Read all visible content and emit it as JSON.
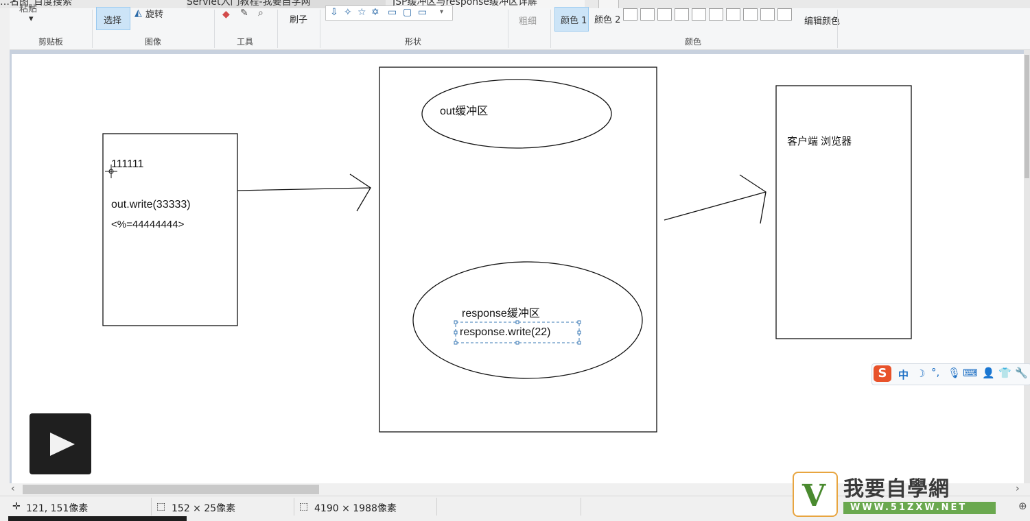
{
  "browser_tabs": [
    {
      "label": "…名图_百度搜索"
    },
    {
      "label": "Servlet入门教程-我要自学网"
    },
    {
      "label": "JSP缓冲区与response缓冲区详解"
    }
  ],
  "ribbon": {
    "clipboard": {
      "paste_label": "粘贴",
      "group_label": "剪贴板"
    },
    "image": {
      "select_label": "选择",
      "rotate_label": "旋转",
      "group_label": "图像"
    },
    "tools": {
      "group_label": "工具"
    },
    "brushes": {
      "label": "刷子"
    },
    "shapes": {
      "group_label": "形状"
    },
    "size": {
      "label": "粗细"
    },
    "colors": {
      "color1_label": "颜色 1",
      "color2_label": "颜色 2",
      "edit_label": "编辑颜色",
      "group_label": "颜色"
    }
  },
  "drawing": {
    "jsp_box": {
      "line1": "111111",
      "line2": "out.write(33333)",
      "line3": "<%=44444444>"
    },
    "server_box": {
      "out_buffer_label": "out缓冲区",
      "response_buffer_label": "response缓冲区",
      "response_write_text": "response.write(22)"
    },
    "client_box": {
      "label": "客户端 浏览器"
    }
  },
  "statusbar": {
    "cursor_pos": "121, 151像素",
    "selection_size": "152 × 25像素",
    "image_size": "4190 × 1988像素"
  },
  "ime": {
    "mode_label": "中"
  },
  "watermark": {
    "brand": "我要自學網",
    "url": "WWW.51ZXW.NET"
  },
  "colors": {
    "accent": "#cce4f7",
    "canvas_bg": "#c8d1de",
    "selection_dash": "#3a78b5"
  }
}
